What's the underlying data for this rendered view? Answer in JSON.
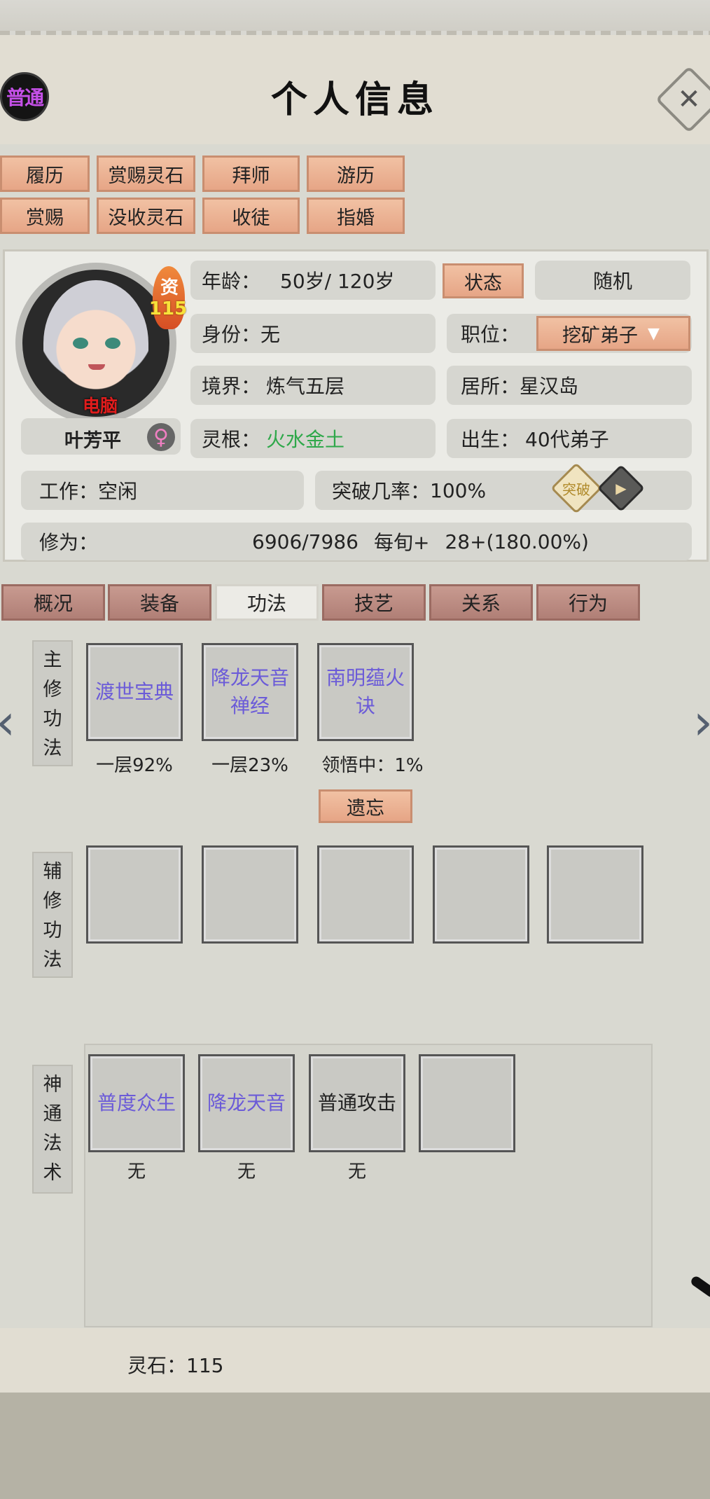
{
  "header": {
    "title": "个人信息",
    "rank_badge": "普通",
    "close_icon": "✕"
  },
  "actions": {
    "row1": [
      "履历",
      "赏赐灵石",
      "拜师",
      "游历"
    ],
    "row2": [
      "赏赐",
      "没收灵石",
      "收徒",
      "指婚"
    ]
  },
  "character": {
    "aptitude_label": "资",
    "aptitude_value": "115",
    "controller_tag": "电脑",
    "name": "叶芳平",
    "gender_icon": "♀",
    "age_label": "年龄：",
    "age_value": "50岁/ 120岁",
    "status_button": "状态",
    "status_value": "随机",
    "identity_label": "身份：",
    "identity_value": "无",
    "position_label": "职位：",
    "position_value": "挖矿弟子",
    "position_dropdown_icon": "▼",
    "realm_label": "境界：",
    "realm_value": "炼气五层",
    "residence_label": "居所：",
    "residence_value": "星汉岛",
    "root_label": "灵根：",
    "root_value": "火水金土",
    "birth_label": "出生：",
    "birth_value": "40代弟子",
    "work_label": "工作：",
    "work_value": "空闲",
    "breakthrough_label": "突破几率：",
    "breakthrough_value": "100%",
    "breakthrough_icon_text": "突破",
    "cultivation_label": "修为：",
    "cultivation_value": "6906/7986",
    "per_turn_label": "每旬+",
    "per_turn_value": "28+(180.00%)"
  },
  "tabs": [
    "概况",
    "装备",
    "功法",
    "技艺",
    "关系",
    "行为"
  ],
  "active_tab": "功法",
  "skills": {
    "main_label": [
      "主",
      "修",
      "功",
      "法"
    ],
    "main_slots": [
      {
        "name": "渡世宝典",
        "progress": "一层92%"
      },
      {
        "name": "降龙天音禅经",
        "progress": "一层23%"
      },
      {
        "name": "南明蕴火诀",
        "progress": "领悟中：1%"
      }
    ],
    "forget_button": "遗忘",
    "aux_label": [
      "辅",
      "修",
      "功",
      "法"
    ],
    "ability_label": [
      "神",
      "通",
      "法",
      "术"
    ],
    "ability_slots": [
      {
        "name": "普度众生",
        "level": "无",
        "color": "#6b5bd8"
      },
      {
        "name": "降龙天音",
        "level": "无",
        "color": "#6b5bd8"
      },
      {
        "name": "普通攻击",
        "level": "无",
        "color": "#222222"
      }
    ]
  },
  "footer": {
    "stones_label": "灵石：",
    "stones_value": "115"
  },
  "nav": {
    "left_icon": "‹",
    "right_icon": "›"
  }
}
